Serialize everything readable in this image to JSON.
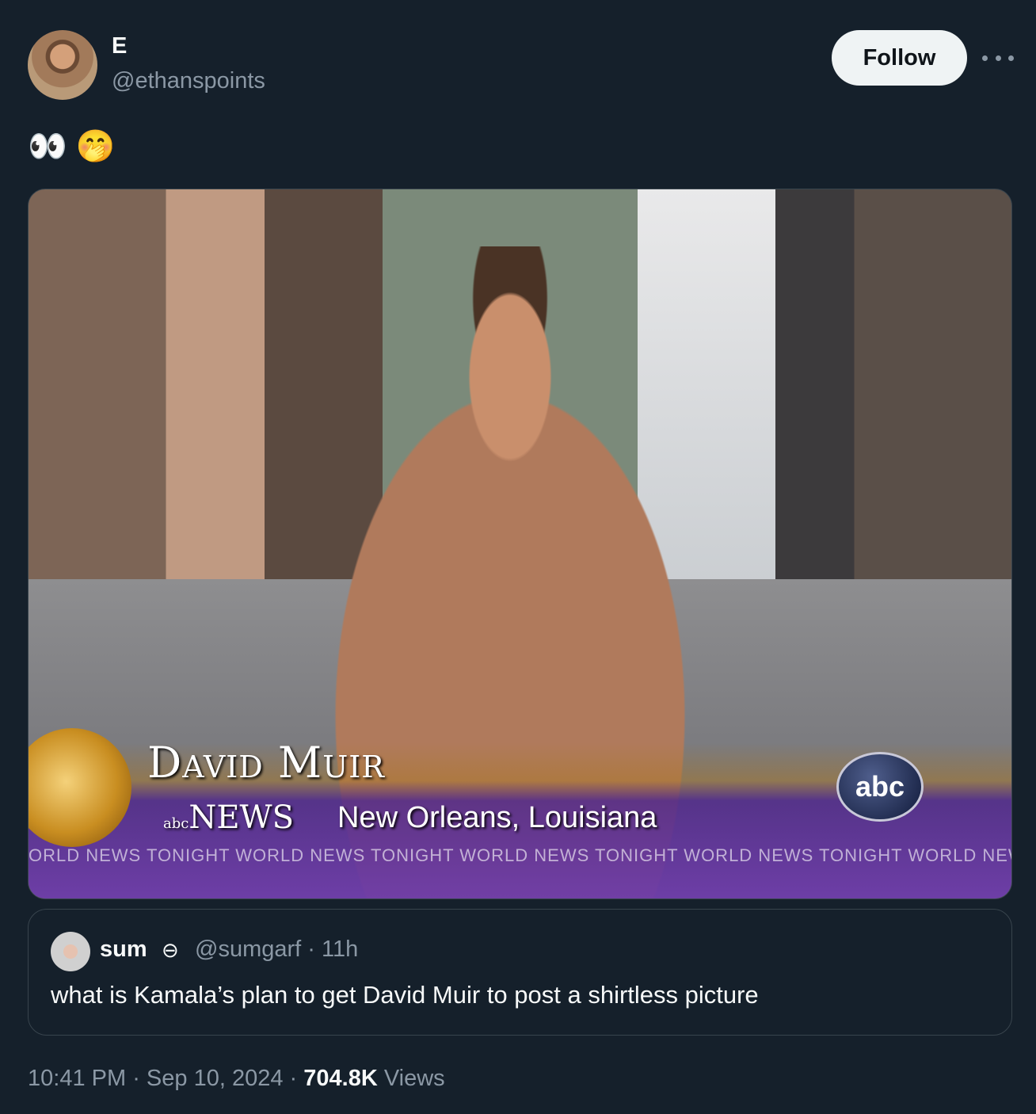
{
  "author": {
    "display_name": "E",
    "handle": "@ethanspoints"
  },
  "follow_label": "Follow",
  "tweet_text": "👀 🤭",
  "media": {
    "name_line": "David Muir",
    "news_label": "NEWS",
    "network_small": "abc",
    "location": "New Orleans, Louisiana",
    "ticker": "ORLD NEWS TONIGHT  WORLD NEWS TONIGHT  WORLD NEWS TONIGHT  WORLD NEWS TONIGHT  WORLD NEWS TO",
    "logo_text": "abc"
  },
  "quoted": {
    "display_name": "sum",
    "badge": "⊖",
    "meta": "@sumgarf · 11h",
    "text": "what is Kamala’s plan to get David Muir to post a shirtless picture"
  },
  "footer": {
    "time": "10:41 PM",
    "sep1": " · ",
    "date": "Sep 10, 2024",
    "sep2": " · ",
    "views_count": "704.8K",
    "views_label": " Views"
  },
  "colors": {
    "background": "#15202b",
    "text": "#f7f9f9",
    "secondary": "#8b98a5",
    "border": "#38444d"
  }
}
